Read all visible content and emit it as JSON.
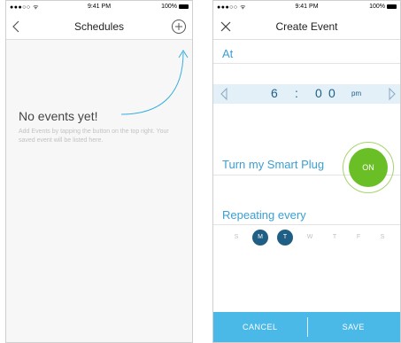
{
  "status": {
    "signal": "●●●○○ ᯤ",
    "time": "9:41 PM",
    "battery": "100%"
  },
  "schedules": {
    "title": "Schedules",
    "empty_title": "No events yet!",
    "empty_hint": "Add Events by tapping the button on the top right. Your saved event will be listed here."
  },
  "create": {
    "title": "Create Event",
    "at_label": "At",
    "time": {
      "hour": "6",
      "separator": ":",
      "minute_tens": "0",
      "minute_ones": "0",
      "ampm": "pm"
    },
    "plug_label": "Turn my Smart Plug",
    "on_label": "ON",
    "repeat_label": "Repeating every",
    "days": [
      {
        "label": "S",
        "active": false
      },
      {
        "label": "M",
        "active": true
      },
      {
        "label": "T",
        "active": true
      },
      {
        "label": "W",
        "active": false
      },
      {
        "label": "T",
        "active": false
      },
      {
        "label": "F",
        "active": false
      },
      {
        "label": "S",
        "active": false
      }
    ],
    "cancel_label": "CANCEL",
    "save_label": "SAVE"
  },
  "colors": {
    "accent": "#3a9fd2",
    "dark_blue": "#1f5e85",
    "green": "#6abf26",
    "footer": "#4ab9e8"
  }
}
